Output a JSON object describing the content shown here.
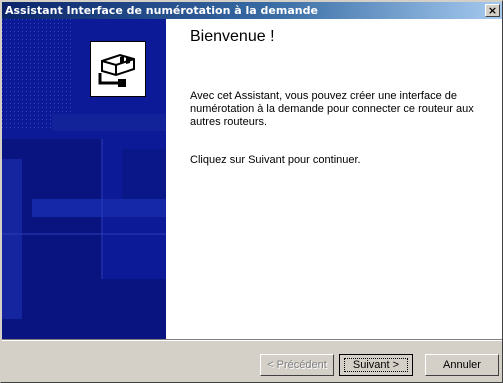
{
  "window": {
    "title": "Assistant Interface de numérotation à la demande",
    "close_label": "×"
  },
  "content": {
    "heading": "Bienvenue !",
    "paragraph1": "Avec cet Assistant, vous pouvez créer une interface de numérotation à la demande pour connecter ce routeur aux autres routeurs.",
    "paragraph2": "Cliquez sur Suivant pour continuer."
  },
  "buttons": {
    "back": "< Précédent",
    "next": "Suivant >",
    "cancel": "Annuler"
  },
  "colors": {
    "titlebar": "#0a246a",
    "panel": "#0c1a98",
    "face": "#d4d0c8"
  },
  "icons": {
    "wizard": "network-connector-icon"
  }
}
